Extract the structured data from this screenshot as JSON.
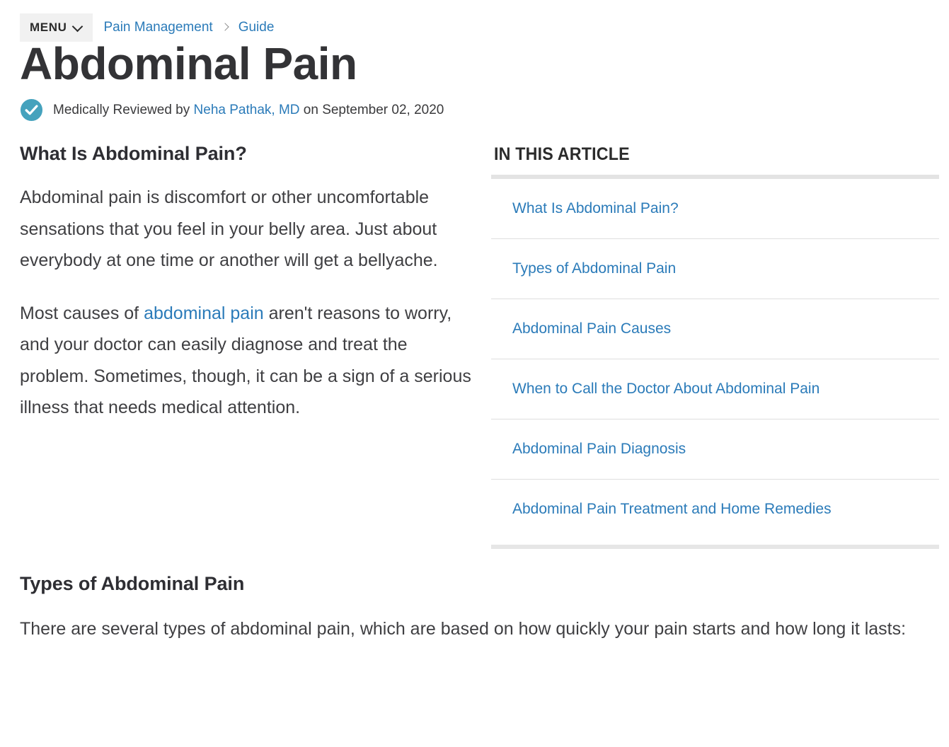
{
  "topbar": {
    "menu_label": "MENU",
    "menu_icon": "chevron-down-icon",
    "breadcrumb": [
      {
        "label": "Pain Management"
      },
      {
        "label": "Guide"
      }
    ]
  },
  "header": {
    "title": "Abdominal Pain",
    "byline": {
      "badge_icon": "verified-check-icon",
      "badge_color": "#45a2bd",
      "prefix": "Medically Reviewed by ",
      "reviewer": "Neha Pathak, MD",
      "suffix": " on September 02, 2020"
    }
  },
  "article": {
    "sections": [
      {
        "heading": "What Is Abdominal Pain?",
        "paragraphs": [
          {
            "parts": [
              {
                "type": "text",
                "text": "Abdominal pain is discomfort or other uncomfortable sensations that you feel in your belly area. Just about everybody at one time or another will get a bellyache."
              }
            ]
          },
          {
            "parts": [
              {
                "type": "text",
                "text": "Most causes of "
              },
              {
                "type": "link",
                "text": "abdominal pain"
              },
              {
                "type": "text",
                "text": " aren't reasons to worry, and your doctor can easily diagnose and treat the problem. Sometimes, though, it can be a sign of a serious illness that needs medical attention."
              }
            ]
          }
        ]
      }
    ],
    "lower_section": {
      "heading": "Types of Abdominal Pain",
      "paragraph": "There are several types of abdominal pain, which are based on how quickly your pain starts and how long it lasts:"
    }
  },
  "toc": {
    "title": "IN THIS ARTICLE",
    "items": [
      {
        "label": "What Is Abdominal Pain?"
      },
      {
        "label": "Types of Abdominal Pain"
      },
      {
        "label": "Abdominal Pain Causes"
      },
      {
        "label": "When to Call the Doctor About Abdominal Pain"
      },
      {
        "label": "Abdominal Pain Diagnosis"
      },
      {
        "label": "Abdominal Pain Treatment and Home Remedies"
      }
    ]
  },
  "colors": {
    "link": "#2b7bb9",
    "heading": "#2e2e33",
    "body": "#3f3f42",
    "rule": "#e3e3e3"
  }
}
